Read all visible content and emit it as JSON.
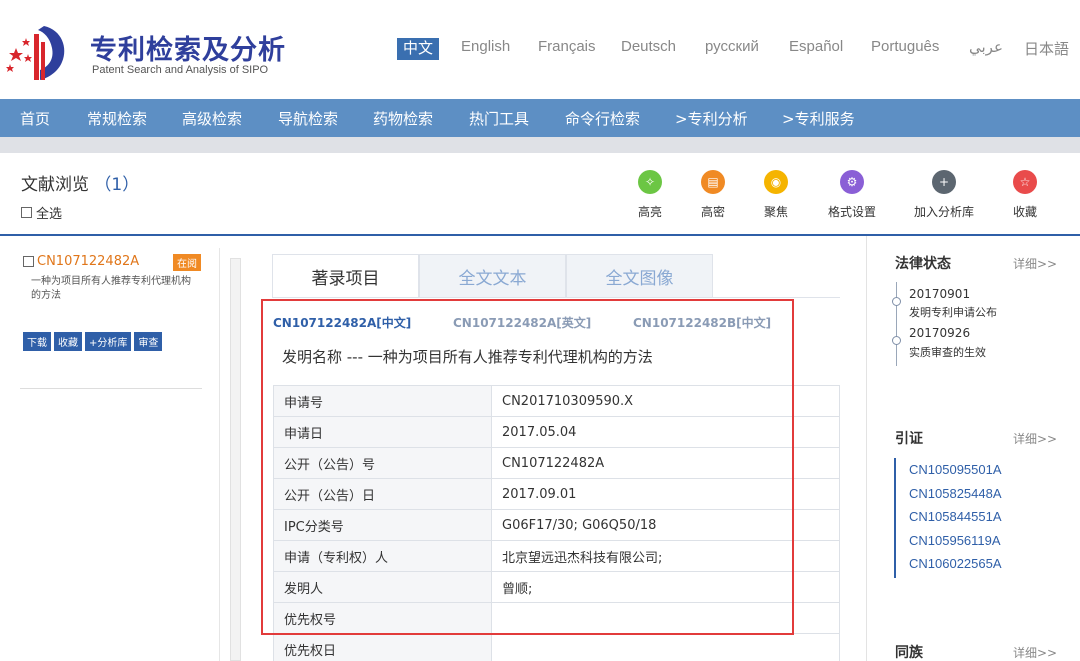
{
  "header": {
    "title": "专利检索及分析",
    "subtitle": "Patent Search and Analysis of SIPO",
    "languages": [
      "中文",
      "English",
      "Français",
      "Deutsch",
      "русский",
      "Español",
      "Português",
      "عربي",
      "日本語"
    ]
  },
  "nav": {
    "items": [
      "首页",
      "常规检索",
      "高级检索",
      "导航检索",
      "药物检索",
      "热门工具",
      "命令行检索",
      ">专利分析",
      ">专利服务"
    ]
  },
  "browse": {
    "title": "文献浏览",
    "count": "1",
    "select_all": "全选"
  },
  "tools": [
    {
      "label": "高亮",
      "icon": "lightbulb-icon",
      "glyph": "✧",
      "color": "#6cc644"
    },
    {
      "label": "高密",
      "icon": "document-icon",
      "glyph": "▤",
      "color": "#f08a24"
    },
    {
      "label": "聚焦",
      "icon": "eye-icon",
      "glyph": "◉",
      "color": "#f5b400"
    },
    {
      "label": "格式设置",
      "icon": "gear-icon",
      "glyph": "⚙",
      "color": "#8a5fd6"
    },
    {
      "label": "加入分析库",
      "icon": "plus-icon",
      "glyph": "+",
      "color": "#5c6670"
    },
    {
      "label": "收藏",
      "icon": "star-icon",
      "glyph": "☆",
      "color": "#e94b4b"
    }
  ],
  "left": {
    "id": "CN107122482A",
    "badge": "在阅",
    "desc": "一种为项目所有人推荐专利代理机构的方法",
    "buttons": [
      "下载",
      "收藏",
      "+分析库",
      "审查"
    ]
  },
  "tabs": [
    "著录项目",
    "全文文本",
    "全文图像"
  ],
  "versions": [
    "CN107122482A[中文]",
    "CN107122482A[英文]",
    "CN107122482B[中文]"
  ],
  "invention_title": "发明名称 --- 一种为项目所有人推荐专利代理机构的方法",
  "biblio": [
    {
      "key": "申请号",
      "value": "CN201710309590.X"
    },
    {
      "key": "申请日",
      "value": "2017.05.04"
    },
    {
      "key": "公开（公告）号",
      "value": "CN107122482A"
    },
    {
      "key": "公开（公告）日",
      "value": "2017.09.01"
    },
    {
      "key": "IPC分类号",
      "value": "G06F17/30; G06Q50/18"
    },
    {
      "key": "申请（专利权）人",
      "value": "北京望远迅杰科技有限公司;"
    },
    {
      "key": "发明人",
      "value": "曾顺;"
    },
    {
      "key": "优先权号",
      "value": ""
    },
    {
      "key": "优先权日",
      "value": ""
    }
  ],
  "right": {
    "legal_title": "法律状态",
    "more": "详细>>",
    "legal_events": [
      {
        "date": "20170901",
        "text": "发明专利申请公布"
      },
      {
        "date": "20170926",
        "text": "实质审查的生效"
      }
    ],
    "cite_title": "引证",
    "citations": [
      "CN105095501A",
      "CN105825448A",
      "CN105844551A",
      "CN105956119A",
      "CN106022565A"
    ],
    "family_title": "同族"
  }
}
